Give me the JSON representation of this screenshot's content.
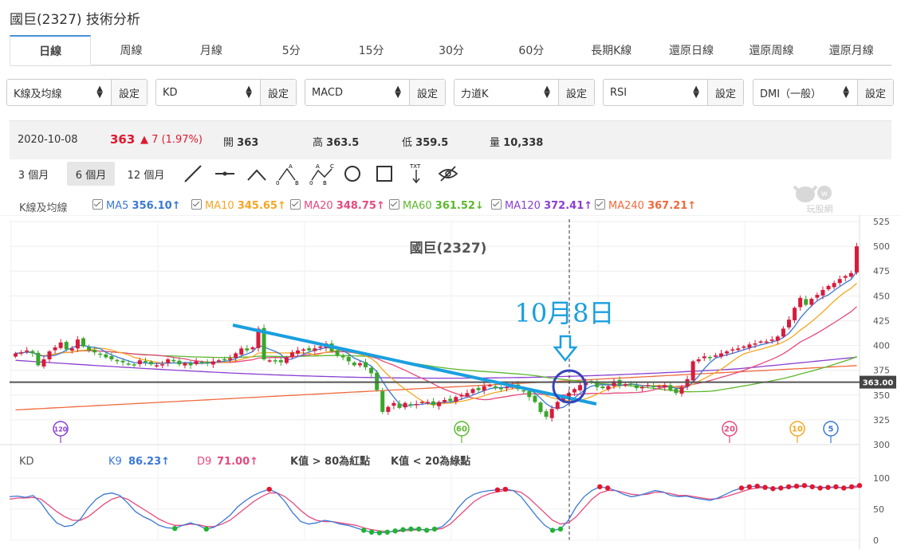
{
  "page": {
    "title": "國巨(2327) 技術分析"
  },
  "tabs": [
    "日線",
    "周線",
    "月線",
    "5分",
    "15分",
    "30分",
    "60分",
    "長期K線",
    "還原日線",
    "還原周線",
    "還原月線"
  ],
  "selectors": [
    {
      "value": "K線及均線",
      "button": "設定"
    },
    {
      "value": "KD",
      "button": "設定"
    },
    {
      "value": "MACD",
      "button": "設定"
    },
    {
      "value": "力道K",
      "button": "設定"
    },
    {
      "value": "RSI",
      "button": "設定"
    },
    {
      "value": "DMI（一般）",
      "button": "設定"
    }
  ],
  "quote": {
    "date": "2020-10-08",
    "price": "363",
    "change": "▲ 7 (1.97%)",
    "open_label": "開",
    "open": "363",
    "high_label": "高",
    "high": "363.5",
    "low_label": "低",
    "low": "359.5",
    "vol_label": "量",
    "vol": "10,338"
  },
  "ranges": [
    "3 個月",
    "6 個月",
    "12 個月"
  ],
  "tool_icons": [
    "line-tool-icon",
    "segment-tool-icon",
    "angle-tool-icon",
    "abc-pattern-icon",
    "abcd-pattern-icon",
    "circle-tool-icon",
    "rect-tool-icon",
    "text-tool-icon",
    "hide-eye-icon"
  ],
  "tool_text": {
    "abc_a": "A",
    "abc_0": "0",
    "abc_b": "B",
    "abcd_a": "A",
    "abcd_c": "C",
    "abcd_0": "0",
    "abcd_b": "B",
    "txt": "TXT"
  },
  "watermark": "玩股網",
  "legend": {
    "label": "K線及均線",
    "items": [
      {
        "name": "MA5",
        "value": "356.10↑",
        "color": "#3a78d6"
      },
      {
        "name": "MA10",
        "value": "345.65↑",
        "color": "#f5a623"
      },
      {
        "name": "MA20",
        "value": "348.75↑",
        "color": "#e64a7d"
      },
      {
        "name": "MA60",
        "value": "361.52↓",
        "color": "#5cb82e"
      },
      {
        "name": "MA120",
        "value": "372.41↑",
        "color": "#8a3fd1"
      },
      {
        "name": "MA240",
        "value": "367.21↑",
        "color": "#f06a3c"
      }
    ]
  },
  "kd_legend": {
    "label": "KD",
    "k_name": "K9",
    "k_value": "86.23↑",
    "d_name": "D9",
    "d_value": "71.00↑",
    "note1": "K值 > 80為紅點",
    "note2": "K值 < 20為綠點"
  },
  "colors": {
    "up": "#d81b3c",
    "down": "#3aa62d",
    "accent": "#1a9fe0",
    "circle": "#3344bb",
    "k_line": "#3a78d6",
    "d_line": "#e64a7d"
  },
  "chart_data": {
    "type": "candlestick",
    "title": "國巨(2327)",
    "annotation": "10月8日",
    "price_tag": "363.00",
    "ylim": [
      300,
      525
    ],
    "yticks": [
      300,
      325,
      350,
      375,
      400,
      425,
      450,
      475,
      500,
      525
    ],
    "ma_markers": [
      {
        "label": "120",
        "color": "#8a3fd1"
      },
      {
        "label": "60",
        "color": "#5cb82e"
      },
      {
        "label": "20",
        "color": "#e64a7d"
      },
      {
        "label": "10",
        "color": "#f5a623"
      },
      {
        "label": "5",
        "color": "#3a78d6"
      }
    ],
    "closes": [
      392,
      393,
      395,
      392,
      380,
      386,
      394,
      398,
      403,
      396,
      397,
      406,
      399,
      395,
      393,
      391,
      388,
      386,
      384,
      383,
      381,
      380,
      385,
      383,
      381,
      380,
      381,
      386,
      384,
      381,
      382,
      380,
      384,
      383,
      382,
      384,
      385,
      386,
      387,
      392,
      397,
      395,
      398,
      417,
      386,
      385,
      384,
      383,
      388,
      393,
      395,
      396,
      395,
      397,
      399,
      402,
      394,
      390,
      388,
      384,
      380,
      382,
      378,
      372,
      355,
      333,
      338,
      342,
      337,
      342,
      340,
      341,
      343,
      343,
      340,
      343,
      345,
      344,
      348,
      350,
      352,
      356,
      355,
      359,
      360,
      357,
      356,
      358,
      360,
      356,
      354,
      348,
      343,
      333,
      328,
      336,
      343,
      348,
      352,
      356,
      360,
      363,
      364,
      358,
      357,
      359,
      364,
      360,
      361,
      361,
      357,
      358,
      360,
      358,
      359,
      360,
      355,
      352,
      358,
      366,
      384,
      386,
      389,
      388,
      390,
      392,
      394,
      396,
      397,
      399,
      401,
      402,
      404,
      404,
      406,
      409,
      417,
      426,
      438,
      448,
      441,
      447,
      451,
      456,
      460,
      463,
      467,
      470,
      473,
      500
    ],
    "ma_series": {
      "MA5": [],
      "MA10": [],
      "MA20": [],
      "MA60": [],
      "MA120": [],
      "MA240": []
    },
    "kd": {
      "ylim": [
        0,
        100
      ],
      "yticks": [
        0,
        50,
        100
      ],
      "K": [
        70,
        71,
        69,
        72,
        60,
        42,
        28,
        22,
        24,
        34,
        52,
        66,
        74,
        76,
        72,
        60,
        46,
        38,
        32,
        24,
        20,
        19,
        24,
        28,
        24,
        18,
        21,
        30,
        40,
        54,
        64,
        72,
        78,
        82,
        76,
        62,
        44,
        30,
        26,
        28,
        32,
        30,
        26,
        24,
        20,
        16,
        13,
        12,
        13,
        15,
        17,
        18,
        18,
        16,
        18,
        22,
        34,
        52,
        66,
        74,
        78,
        80,
        81,
        82,
        80,
        70,
        54,
        38,
        24,
        16,
        18,
        32,
        54,
        70,
        80,
        86,
        84,
        80,
        74,
        70,
        72,
        76,
        80,
        78,
        72,
        70,
        71,
        68,
        66,
        64,
        68,
        74,
        80,
        84,
        86,
        87,
        85,
        83,
        84,
        86,
        87,
        88,
        86,
        84,
        85,
        86,
        84,
        86,
        88
      ],
      "D": [
        66,
        68,
        68,
        69,
        66,
        56,
        46,
        38,
        32,
        32,
        38,
        48,
        58,
        66,
        70,
        66,
        58,
        50,
        42,
        34,
        28,
        24,
        24,
        26,
        25,
        22,
        22,
        26,
        32,
        42,
        52,
        62,
        70,
        76,
        76,
        70,
        60,
        48,
        38,
        32,
        30,
        30,
        28,
        26,
        24,
        20,
        17,
        15,
        14,
        14,
        15,
        16,
        17,
        17,
        17,
        19,
        26,
        38,
        50,
        62,
        70,
        75,
        78,
        80,
        80,
        77,
        68,
        56,
        44,
        32,
        26,
        28,
        38,
        52,
        66,
        76,
        80,
        80,
        77,
        74,
        73,
        74,
        77,
        77,
        75,
        72,
        72,
        70,
        68,
        66,
        67,
        70,
        74,
        78,
        82,
        84,
        85,
        84,
        84,
        85,
        86,
        87,
        86,
        85,
        85,
        85,
        84,
        84,
        86
      ]
    }
  }
}
